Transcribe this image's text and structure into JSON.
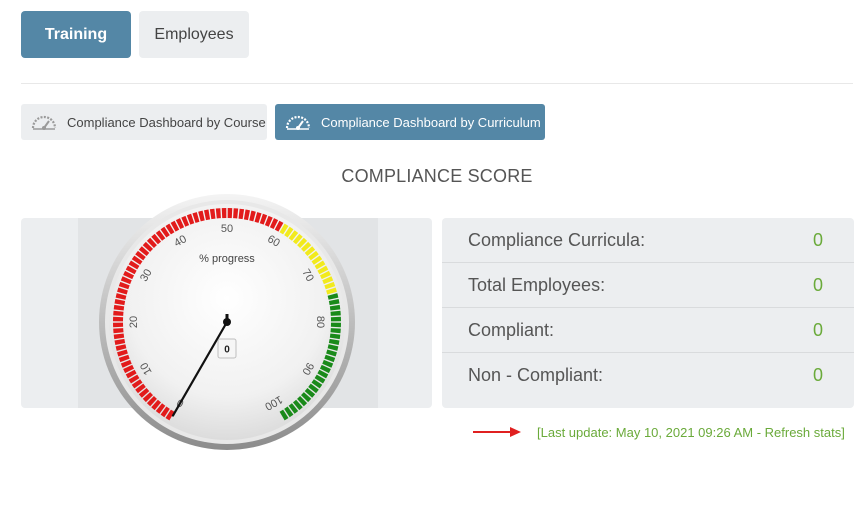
{
  "tabs": {
    "training": "Training",
    "employees": "Employees"
  },
  "subtabs": {
    "by_course": "Compliance Dashboard by Course",
    "by_curriculum": "Compliance Dashboard by Curriculum"
  },
  "section_title": "COMPLIANCE SCORE",
  "gauge": {
    "label": "% progress",
    "value": 0,
    "value_text": "0",
    "ticks": [
      "0",
      "10",
      "20",
      "30",
      "40",
      "50",
      "60",
      "70",
      "80",
      "90",
      "100"
    ],
    "bands": [
      {
        "from": 0,
        "to": 60,
        "color": "#e21b1b"
      },
      {
        "from": 60,
        "to": 75,
        "color": "#f2ea1d"
      },
      {
        "from": 75,
        "to": 100,
        "color": "#1a8a1a"
      }
    ]
  },
  "stats": [
    {
      "label": "Compliance Curricula:",
      "value": "0"
    },
    {
      "label": "Total Employees:",
      "value": "0"
    },
    {
      "label": "Compliant:",
      "value": "0"
    },
    {
      "label": "Non - Compliant:",
      "value": "0"
    }
  ],
  "last_update": "[Last update: May 10, 2021 09:26 AM - Refresh stats]",
  "colors": {
    "accent": "#5487a6",
    "green_text": "#6aaa3a",
    "arrow": "#e02020"
  }
}
